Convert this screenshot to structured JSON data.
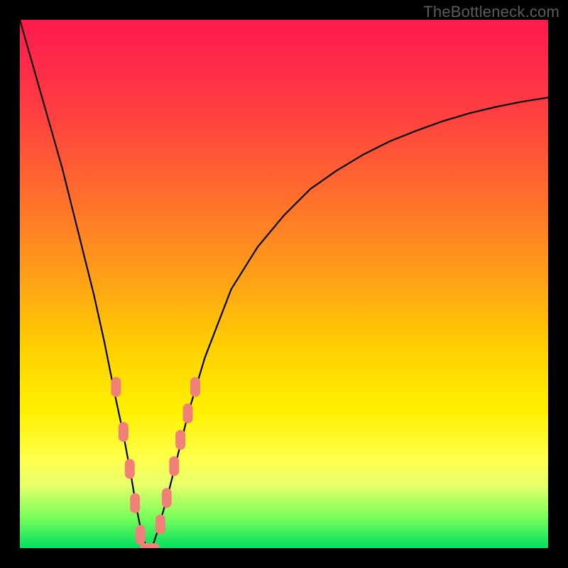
{
  "watermark": "TheBottleneck.com",
  "chart_data": {
    "type": "line",
    "title": "",
    "xlabel": "",
    "ylabel": "",
    "xlim": [
      0,
      100
    ],
    "ylim": [
      0,
      100
    ],
    "grid": false,
    "series": [
      {
        "name": "curve",
        "color": "#000000",
        "x": [
          0,
          2,
          4,
          6,
          8,
          10,
          12,
          14,
          16,
          18,
          19.5,
          21,
          22,
          23,
          24,
          25,
          26,
          28,
          30,
          32,
          35,
          40,
          45,
          50,
          55,
          60,
          65,
          70,
          75,
          80,
          85,
          90,
          95,
          100
        ],
        "y": [
          100,
          93,
          86,
          79,
          72,
          64,
          56,
          48,
          39,
          29,
          22,
          14,
          8,
          3,
          0,
          0,
          3,
          10,
          18,
          26,
          36,
          49,
          57,
          63,
          68,
          71.5,
          74.5,
          77,
          79,
          80.8,
          82.3,
          83.5,
          84.5,
          85.3
        ]
      }
    ],
    "markers": {
      "name": "salmon-pills",
      "color": "#f08078",
      "points": [
        {
          "x": 18.2,
          "y": 30.5,
          "vertical": true
        },
        {
          "x": 19.6,
          "y": 22.0,
          "vertical": true
        },
        {
          "x": 20.8,
          "y": 15.0,
          "vertical": true
        },
        {
          "x": 21.8,
          "y": 8.5,
          "vertical": true
        },
        {
          "x": 22.8,
          "y": 2.5,
          "vertical": true
        },
        {
          "x": 24.6,
          "y": 0.0,
          "vertical": false
        },
        {
          "x": 26.6,
          "y": 4.5,
          "vertical": true
        },
        {
          "x": 27.8,
          "y": 9.5,
          "vertical": true
        },
        {
          "x": 29.2,
          "y": 15.5,
          "vertical": true
        },
        {
          "x": 30.4,
          "y": 20.5,
          "vertical": true
        },
        {
          "x": 31.8,
          "y": 25.5,
          "vertical": true
        },
        {
          "x": 33.2,
          "y": 30.5,
          "vertical": true
        }
      ]
    },
    "background_gradient": {
      "direction": "top-to-bottom",
      "stops": [
        {
          "pos": 0.0,
          "color": "#ff1a4d"
        },
        {
          "pos": 0.08,
          "color": "#ff2a4a"
        },
        {
          "pos": 0.18,
          "color": "#ff4040"
        },
        {
          "pos": 0.32,
          "color": "#ff6a2e"
        },
        {
          "pos": 0.47,
          "color": "#ff9a1a"
        },
        {
          "pos": 0.62,
          "color": "#ffd000"
        },
        {
          "pos": 0.74,
          "color": "#fff000"
        },
        {
          "pos": 0.83,
          "color": "#ffff4a"
        },
        {
          "pos": 0.88,
          "color": "#e8ff6a"
        },
        {
          "pos": 0.94,
          "color": "#7cff5a"
        },
        {
          "pos": 1.0,
          "color": "#00e060"
        }
      ]
    }
  }
}
